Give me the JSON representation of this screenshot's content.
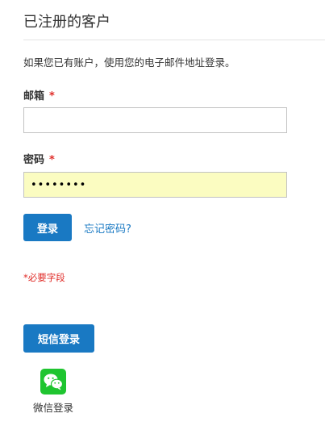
{
  "header": {
    "title": "已注册的客户"
  },
  "login_form": {
    "intro": "如果您已有账户，使用您的电子邮件地址登录。",
    "email": {
      "label": "邮箱",
      "required_mark": "*",
      "value": "",
      "placeholder": ""
    },
    "password": {
      "label": "密码",
      "required_mark": "*",
      "value": "••••••••",
      "placeholder": ""
    },
    "login_button_label": "登录",
    "forgot_password_link": "忘记密码?",
    "required_note": "*必要字段"
  },
  "alternative_login": {
    "sms_button_label": "短信登录",
    "wechat": {
      "label": "微信登录",
      "icon": "wechat-icon",
      "brand_color": "#1fc530"
    }
  },
  "colors": {
    "accent": "#1979c3",
    "required": "#e02b27",
    "autofill_background": "#fbfcc1"
  }
}
